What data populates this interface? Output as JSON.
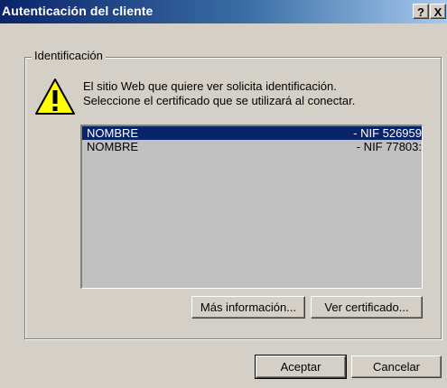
{
  "window": {
    "title": "Autenticación del cliente",
    "help_label": "?",
    "close_label": "X"
  },
  "group": {
    "label": "Identificación"
  },
  "message": {
    "line1": "El sitio Web que quiere ver solicita identificación.",
    "line2": "Seleccione el certificado que se utilizará al conectar."
  },
  "certificates": [
    {
      "name": "NOMBRE",
      "nif": "- NIF 526959",
      "selected": true
    },
    {
      "name": "NOMBRE",
      "nif": "- NIF 77803:",
      "selected": false
    }
  ],
  "buttons": {
    "more_info": "Más información...",
    "view_cert": "Ver certificado...",
    "accept": "Aceptar",
    "cancel": "Cancelar"
  },
  "colors": {
    "face": "#d4d0c8",
    "title_start": "#0a246a",
    "title_end": "#a6caf0",
    "selection": "#0a246a",
    "list_bg": "#c0c0c0"
  },
  "icons": {
    "warning": "warning-icon"
  }
}
